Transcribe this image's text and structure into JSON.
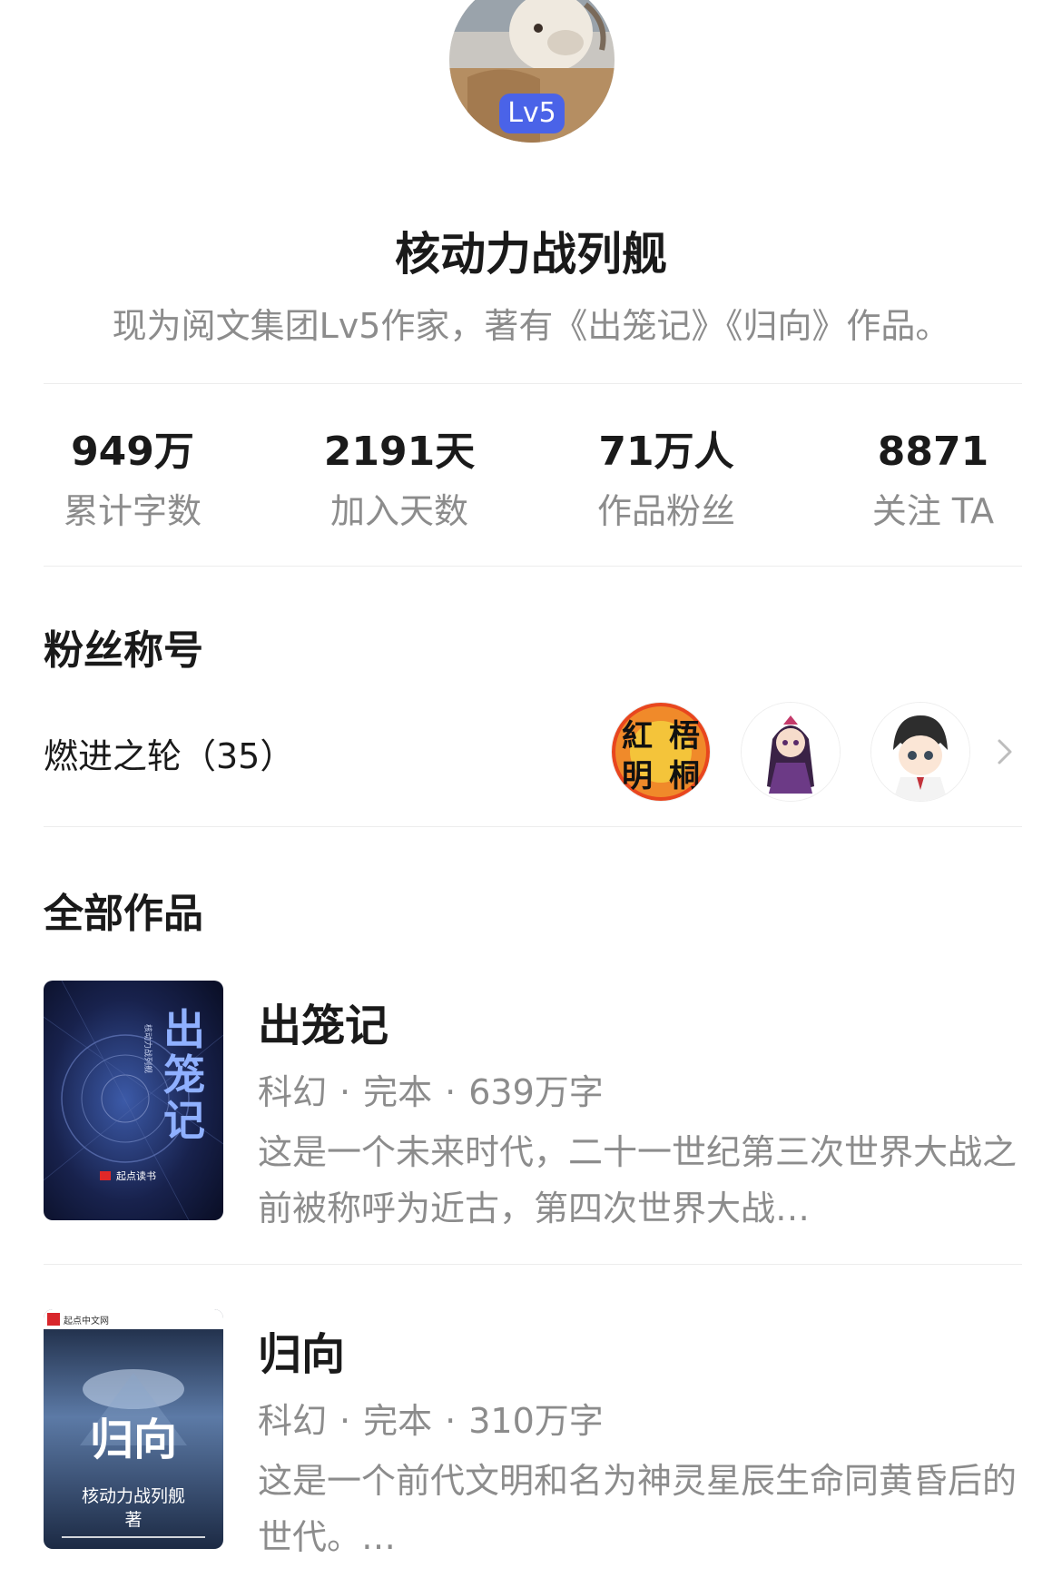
{
  "profile": {
    "level_badge": "Lv5",
    "name": "核动力战列舰",
    "bio": "现为阅文集团Lv5作家，著有《出笼记》《归向》作品。"
  },
  "stats": [
    {
      "value": "949万",
      "label": "累计字数"
    },
    {
      "value": "2191天",
      "label": "加入天数"
    },
    {
      "value": "71万人",
      "label": "作品粉丝"
    },
    {
      "value": "8871",
      "label": "关注 TA"
    }
  ],
  "fans_section": {
    "heading": "粉丝称号",
    "title": "燃进之轮（35）",
    "avatars": [
      {
        "icon": "calligraphy-seal-avatar",
        "chars": [
          "紅",
          "梧",
          "明",
          "桐"
        ]
      },
      {
        "icon": "anime-girl-avatar"
      },
      {
        "icon": "anime-boy-avatar"
      }
    ],
    "chevron_icon": "chevron-right-icon"
  },
  "works_section": {
    "heading": "全部作品",
    "books": [
      {
        "title": "出笼记",
        "genre": "科幻",
        "status": "完本",
        "words": "639万字",
        "description": "这是一个未来时代，二十一世纪第三次世界大战之前被称呼为近古，第四次世界大战…",
        "cover": {
          "title": "出笼记",
          "author": "核动力战列舰",
          "publisher": "起点读书",
          "colors": [
            "#0e1633",
            "#2a3d7a"
          ]
        }
      },
      {
        "title": "归向",
        "genre": "科幻",
        "status": "完本",
        "words": "310万字",
        "description": "这是一个前代文明和名为神灵星辰生命同黄昏后的世代。…",
        "cover": {
          "title": "归向",
          "author": "核动力战列舰",
          "author_suffix": "著",
          "publisher": "起点中文网",
          "colors": [
            "#1b2b48",
            "#6d8cb5"
          ]
        }
      }
    ]
  },
  "colors": {
    "badge": "#4a63e8",
    "text_primary": "#1a1a1a",
    "text_secondary": "#8c8c8c",
    "divider": "#ececec"
  }
}
